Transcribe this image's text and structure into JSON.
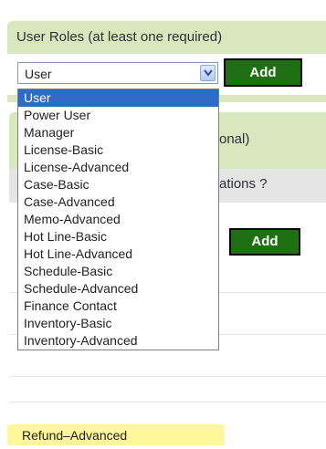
{
  "panel": {
    "title": "User Roles (at least one required)"
  },
  "role_select": {
    "value": "User",
    "add_label": "Add"
  },
  "dropdown": {
    "options": [
      "User",
      "Power User",
      "Manager",
      "License-Basic",
      "License-Advanced",
      "Case-Basic",
      "Case-Advanced",
      "Memo-Advanced",
      "Hot Line-Basic",
      "Hot Line-Advanced",
      "Schedule-Basic",
      "Schedule-Advanced",
      "Finance Contact",
      "Inventory-Basic",
      "Inventory-Advanced"
    ],
    "highlighted_option": "Refund–Advanced",
    "selected_index": 0
  },
  "background": {
    "partial_label_1": "onal)",
    "partial_label_2": "ations ?",
    "add_label": "Add"
  },
  "colors": {
    "panel_bg": "#d8e7bd",
    "button_bg": "#1f6f13",
    "selected_bg": "#3169c6",
    "highlight_bg": "#fff79a"
  }
}
